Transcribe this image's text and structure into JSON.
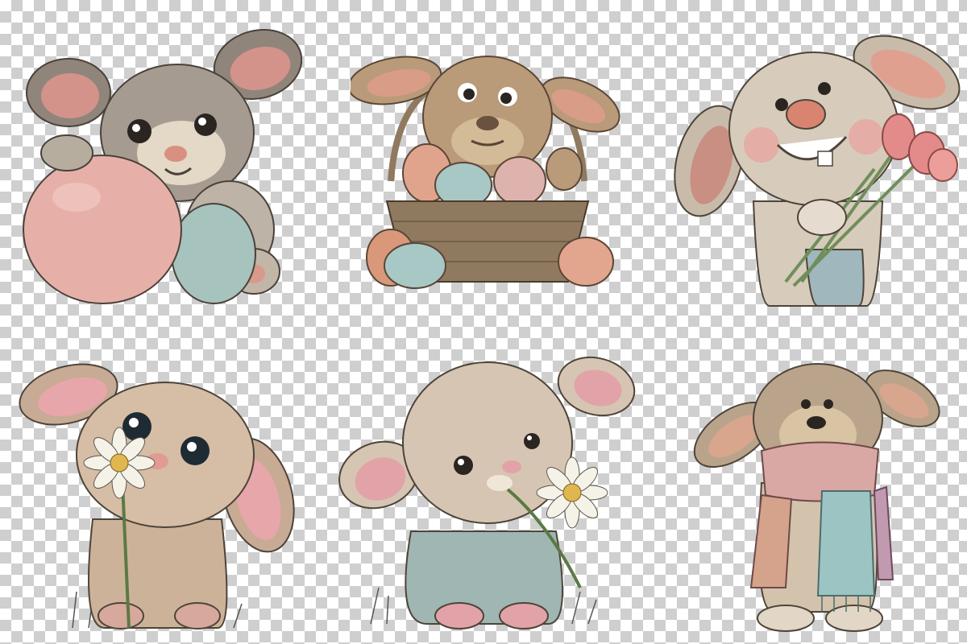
{
  "canvas": {
    "background": "checkerboard-transparency",
    "checker_light": "#ffffff",
    "checker_dark": "#cfcfcf"
  },
  "illustrations": [
    {
      "subject": "bunny-with-pink-egg",
      "palette": [
        "#9e958c",
        "#e6b0a8",
        "#a7c3bd"
      ]
    },
    {
      "subject": "bunny-in-easter-basket",
      "palette": [
        "#b99a79",
        "#8f7a5f",
        "#e0a48d",
        "#a8c8c6"
      ]
    },
    {
      "subject": "bunny-with-pink-tulips",
      "palette": [
        "#d7cbbb",
        "#e38b8a",
        "#9fb7bd"
      ]
    },
    {
      "subject": "bunny-smelling-daisy",
      "palette": [
        "#cdb29a",
        "#e7a6aa",
        "#f5f2e8"
      ]
    },
    {
      "subject": "bunny-sitting-with-daisy",
      "palette": [
        "#d6c5b3",
        "#9fb6b2",
        "#f5f2e8"
      ]
    },
    {
      "subject": "bunny-with-scarf",
      "palette": [
        "#b9a48b",
        "#d9a8a4",
        "#9cc4c3"
      ]
    }
  ]
}
